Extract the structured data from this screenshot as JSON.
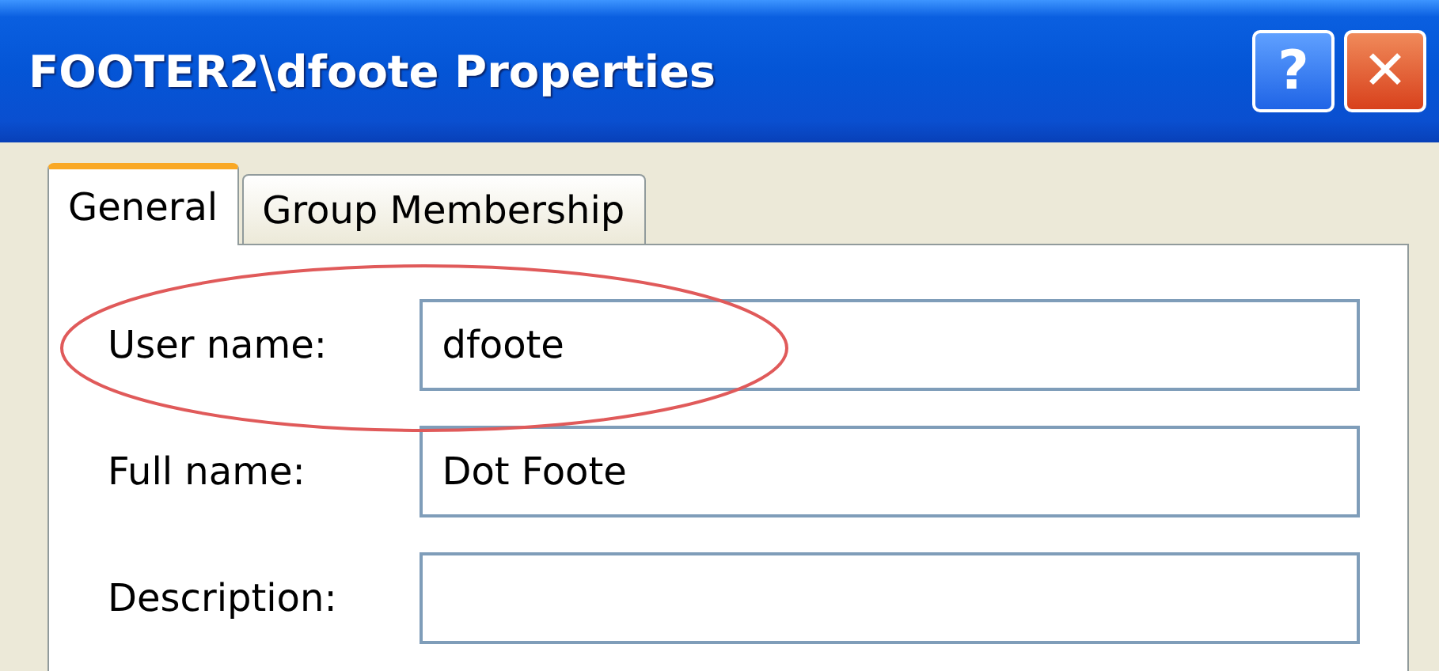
{
  "window": {
    "title": "FOOTER2\\dfoote Properties",
    "help_button": "?",
    "close_button": "✕"
  },
  "tabs": [
    {
      "label": "General",
      "selected": true
    },
    {
      "label": "Group Membership",
      "selected": false
    }
  ],
  "fields": [
    {
      "label": "User name:",
      "value": "dfoote",
      "highlighted": true
    },
    {
      "label": "Full name:",
      "value": "Dot Foote",
      "highlighted": false
    },
    {
      "label": "Description:",
      "highlighted": false
    }
  ]
}
